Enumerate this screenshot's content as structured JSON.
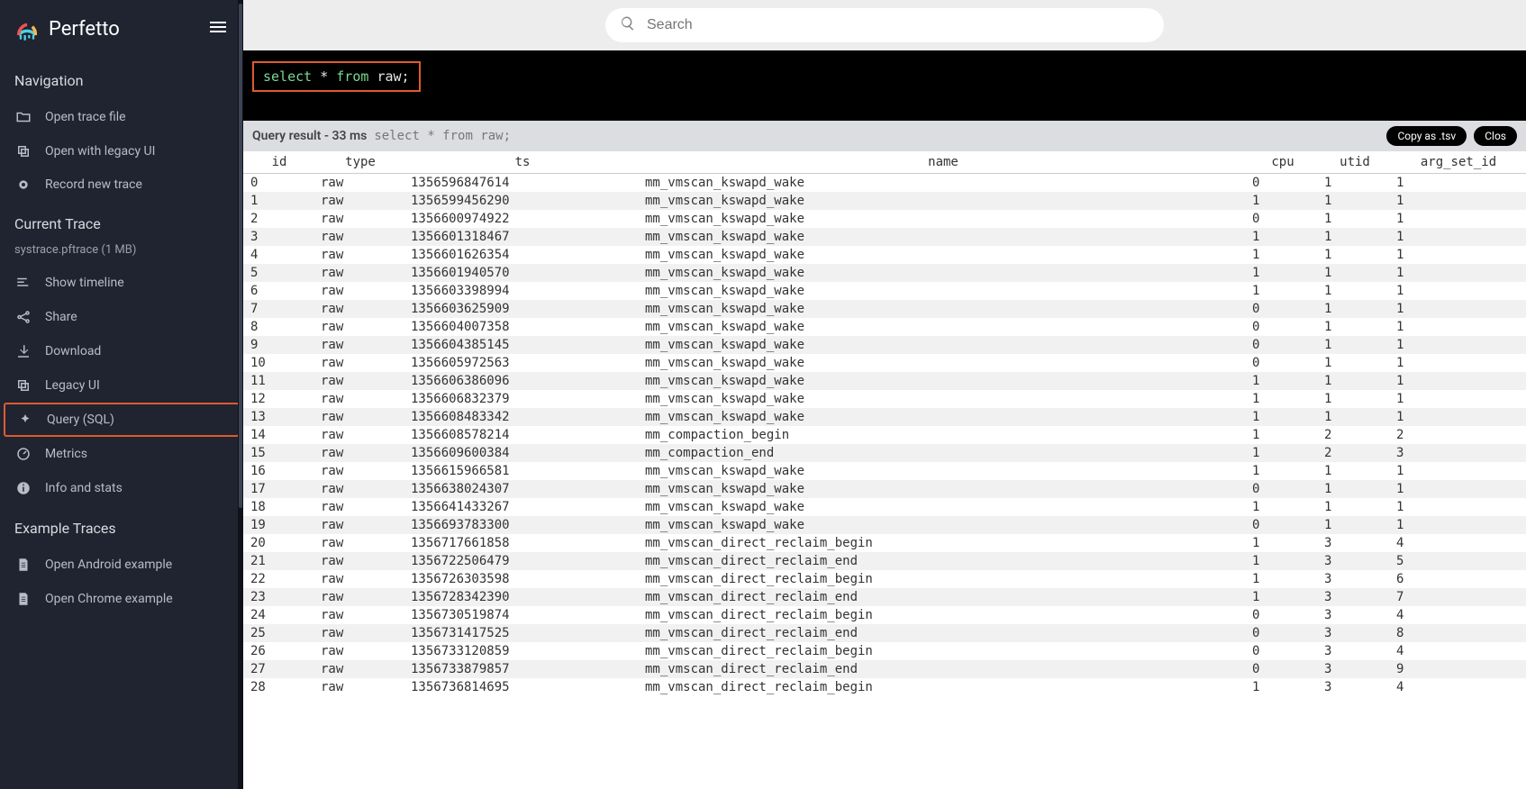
{
  "app": {
    "name": "Perfetto"
  },
  "search": {
    "placeholder": "Search"
  },
  "sidebar": {
    "sections": {
      "navigation": {
        "title": "Navigation",
        "items": [
          {
            "label": "Open trace file"
          },
          {
            "label": "Open with legacy UI"
          },
          {
            "label": "Record new trace"
          }
        ]
      },
      "current_trace": {
        "title": "Current Trace",
        "meta": "systrace.pftrace (1 MB)",
        "items": [
          {
            "label": "Show timeline"
          },
          {
            "label": "Share"
          },
          {
            "label": "Download"
          },
          {
            "label": "Legacy UI"
          },
          {
            "label": "Query (SQL)"
          },
          {
            "label": "Metrics"
          },
          {
            "label": "Info and stats"
          }
        ]
      },
      "example_traces": {
        "title": "Example Traces",
        "items": [
          {
            "label": "Open Android example"
          },
          {
            "label": "Open Chrome example"
          }
        ]
      }
    }
  },
  "query_editor": {
    "sql": "select * from raw;"
  },
  "result_bar": {
    "prefix": "Query result - 33 ms",
    "echo": "select * from raw;",
    "copy_btn": "Copy as .tsv",
    "close_btn": "Clos"
  },
  "table": {
    "columns": [
      "id",
      "type",
      "ts",
      "name",
      "cpu",
      "utid",
      "arg_set_id"
    ],
    "rows": [
      [
        0,
        "raw",
        "1356596847614",
        "mm_vmscan_kswapd_wake",
        0,
        1,
        1
      ],
      [
        1,
        "raw",
        "1356599456290",
        "mm_vmscan_kswapd_wake",
        1,
        1,
        1
      ],
      [
        2,
        "raw",
        "1356600974922",
        "mm_vmscan_kswapd_wake",
        0,
        1,
        1
      ],
      [
        3,
        "raw",
        "1356601318467",
        "mm_vmscan_kswapd_wake",
        1,
        1,
        1
      ],
      [
        4,
        "raw",
        "1356601626354",
        "mm_vmscan_kswapd_wake",
        1,
        1,
        1
      ],
      [
        5,
        "raw",
        "1356601940570",
        "mm_vmscan_kswapd_wake",
        1,
        1,
        1
      ],
      [
        6,
        "raw",
        "1356603398994",
        "mm_vmscan_kswapd_wake",
        1,
        1,
        1
      ],
      [
        7,
        "raw",
        "1356603625909",
        "mm_vmscan_kswapd_wake",
        0,
        1,
        1
      ],
      [
        8,
        "raw",
        "1356604007358",
        "mm_vmscan_kswapd_wake",
        0,
        1,
        1
      ],
      [
        9,
        "raw",
        "1356604385145",
        "mm_vmscan_kswapd_wake",
        0,
        1,
        1
      ],
      [
        10,
        "raw",
        "1356605972563",
        "mm_vmscan_kswapd_wake",
        0,
        1,
        1
      ],
      [
        11,
        "raw",
        "1356606386096",
        "mm_vmscan_kswapd_wake",
        1,
        1,
        1
      ],
      [
        12,
        "raw",
        "1356606832379",
        "mm_vmscan_kswapd_wake",
        1,
        1,
        1
      ],
      [
        13,
        "raw",
        "1356608483342",
        "mm_vmscan_kswapd_wake",
        1,
        1,
        1
      ],
      [
        14,
        "raw",
        "1356608578214",
        "mm_compaction_begin",
        1,
        2,
        2
      ],
      [
        15,
        "raw",
        "1356609600384",
        "mm_compaction_end",
        1,
        2,
        3
      ],
      [
        16,
        "raw",
        "1356615966581",
        "mm_vmscan_kswapd_wake",
        1,
        1,
        1
      ],
      [
        17,
        "raw",
        "1356638024307",
        "mm_vmscan_kswapd_wake",
        0,
        1,
        1
      ],
      [
        18,
        "raw",
        "1356641433267",
        "mm_vmscan_kswapd_wake",
        1,
        1,
        1
      ],
      [
        19,
        "raw",
        "1356693783300",
        "mm_vmscan_kswapd_wake",
        0,
        1,
        1
      ],
      [
        20,
        "raw",
        "1356717661858",
        "mm_vmscan_direct_reclaim_begin",
        1,
        3,
        4
      ],
      [
        21,
        "raw",
        "1356722506479",
        "mm_vmscan_direct_reclaim_end",
        1,
        3,
        5
      ],
      [
        22,
        "raw",
        "1356726303598",
        "mm_vmscan_direct_reclaim_begin",
        1,
        3,
        6
      ],
      [
        23,
        "raw",
        "1356728342390",
        "mm_vmscan_direct_reclaim_end",
        1,
        3,
        7
      ],
      [
        24,
        "raw",
        "1356730519874",
        "mm_vmscan_direct_reclaim_begin",
        0,
        3,
        4
      ],
      [
        25,
        "raw",
        "1356731417525",
        "mm_vmscan_direct_reclaim_end",
        0,
        3,
        8
      ],
      [
        26,
        "raw",
        "1356733120859",
        "mm_vmscan_direct_reclaim_begin",
        0,
        3,
        4
      ],
      [
        27,
        "raw",
        "1356733879857",
        "mm_vmscan_direct_reclaim_end",
        0,
        3,
        9
      ],
      [
        28,
        "raw",
        "1356736814695",
        "mm_vmscan_direct_reclaim_begin",
        1,
        3,
        4
      ]
    ]
  }
}
